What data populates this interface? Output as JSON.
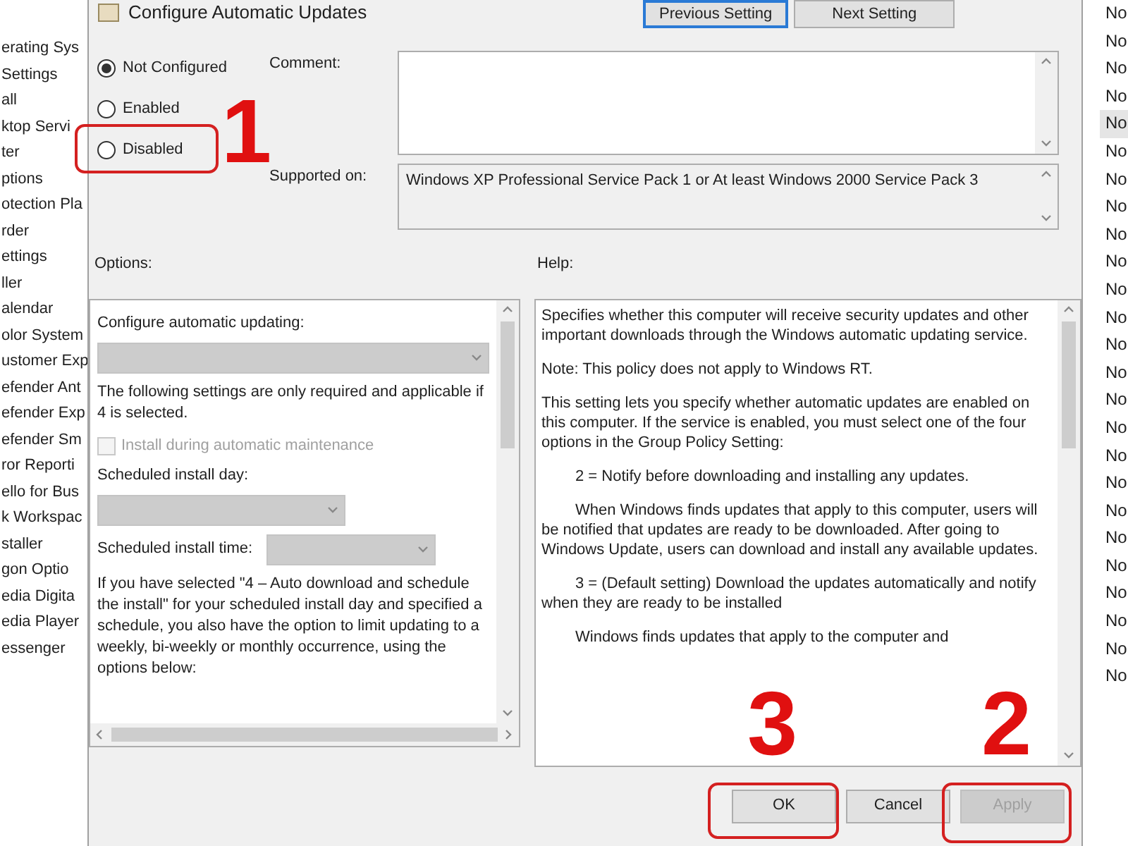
{
  "sidebar": {
    "items": [
      "erating Sys",
      "Settings",
      "all",
      "ktop Servi",
      "ter",
      "ptions",
      "otection Pla",
      "rder",
      "ettings",
      "ller",
      "alendar",
      "olor System",
      "ustomer Exp",
      "efender Ant",
      "efender Exp",
      "efender Sm",
      "ror Reporti",
      "ello for Bus",
      "k Workspac",
      "staller",
      "gon Optio",
      "edia Digita",
      "edia Player",
      "essenger"
    ]
  },
  "dialog": {
    "title": "Configure Automatic Updates",
    "nav_buttons": [
      {
        "label": "Previous Setting",
        "focused": true
      },
      {
        "label": "Next Setting",
        "focused": false
      }
    ],
    "state_options": [
      {
        "label": "Not Configured",
        "selected": true
      },
      {
        "label": "Enabled",
        "selected": false
      },
      {
        "label": "Disabled",
        "selected": false
      }
    ],
    "comment": {
      "label": "Comment:"
    },
    "supported_on": {
      "label": "Supported on:",
      "value": "Windows XP Professional Service Pack 1 or At least Windows 2000 Service Pack 3"
    },
    "options": {
      "label": "Options:",
      "items": [
        {
          "kind": "label",
          "text": "Configure automatic updating:"
        },
        {
          "kind": "dropdown",
          "disabled": true
        },
        {
          "kind": "text",
          "text": "The following settings are only required and applicable if 4 is selected."
        },
        {
          "kind": "checkbox",
          "text": "Install during automatic maintenance",
          "checked": false,
          "disabled": true
        },
        {
          "kind": "label",
          "text": "Scheduled install day:"
        },
        {
          "kind": "dropdown",
          "disabled": true
        },
        {
          "kind": "inline_dropdown",
          "text": "Scheduled install time:",
          "disabled": true
        },
        {
          "kind": "text",
          "text": "If you have selected \"4 – Auto download and schedule the install\" for your scheduled install day and specified a schedule, you also have the option to limit updating to a weekly, bi-weekly or monthly occurrence, using the options below:"
        }
      ]
    },
    "help": {
      "label": "Help:",
      "paragraphs": [
        {
          "text": "Specifies whether this computer will receive security updates and other important downloads through the Windows automatic updating service.",
          "indent": false
        },
        {
          "text": "Note: This policy does not apply to Windows RT.",
          "indent": false
        },
        {
          "text": "This setting lets you specify whether automatic updates are enabled on this computer. If the service is enabled, you must select one of the four options in the Group Policy Setting:",
          "indent": false
        },
        {
          "text": "2 = Notify before downloading and installing any updates.",
          "indent": true
        },
        {
          "text": "When Windows finds updates that apply to this computer, users will be notified that updates are ready to be downloaded. After going to Windows Update, users can download and install any available updates.",
          "indent": true
        },
        {
          "text": "3 = (Default setting) Download the updates automatically and notify when they are ready to be installed",
          "indent": true
        },
        {
          "text": "Windows finds updates that apply to the computer and",
          "indent": true
        }
      ]
    },
    "buttons": [
      {
        "label": "OK",
        "disabled": false
      },
      {
        "label": "Cancel",
        "disabled": false
      },
      {
        "label": "Apply",
        "disabled": true
      }
    ]
  },
  "right_list": {
    "items": [
      {
        "text": "No",
        "selected": false
      },
      {
        "text": "No",
        "selected": false
      },
      {
        "text": "No",
        "selected": false
      },
      {
        "text": "No",
        "selected": false
      },
      {
        "text": "No",
        "selected": true
      },
      {
        "text": "No",
        "selected": false
      },
      {
        "text": "No",
        "selected": false
      },
      {
        "text": "No",
        "selected": false
      },
      {
        "text": "No",
        "selected": false
      },
      {
        "text": "No",
        "selected": false
      },
      {
        "text": "No",
        "selected": false
      },
      {
        "text": "No",
        "selected": false
      },
      {
        "text": "No",
        "selected": false
      },
      {
        "text": "No",
        "selected": false
      },
      {
        "text": "No",
        "selected": false
      },
      {
        "text": "No",
        "selected": false
      },
      {
        "text": "No",
        "selected": false
      },
      {
        "text": "No",
        "selected": false
      },
      {
        "text": "No",
        "selected": false
      },
      {
        "text": "No",
        "selected": false
      },
      {
        "text": "No",
        "selected": false
      },
      {
        "text": "No",
        "selected": false
      },
      {
        "text": "No",
        "selected": false
      },
      {
        "text": "No",
        "selected": false
      },
      {
        "text": "No",
        "selected": false
      }
    ]
  },
  "annotations": [
    {
      "text": "1"
    },
    {
      "text": "3"
    },
    {
      "text": "2"
    }
  ]
}
